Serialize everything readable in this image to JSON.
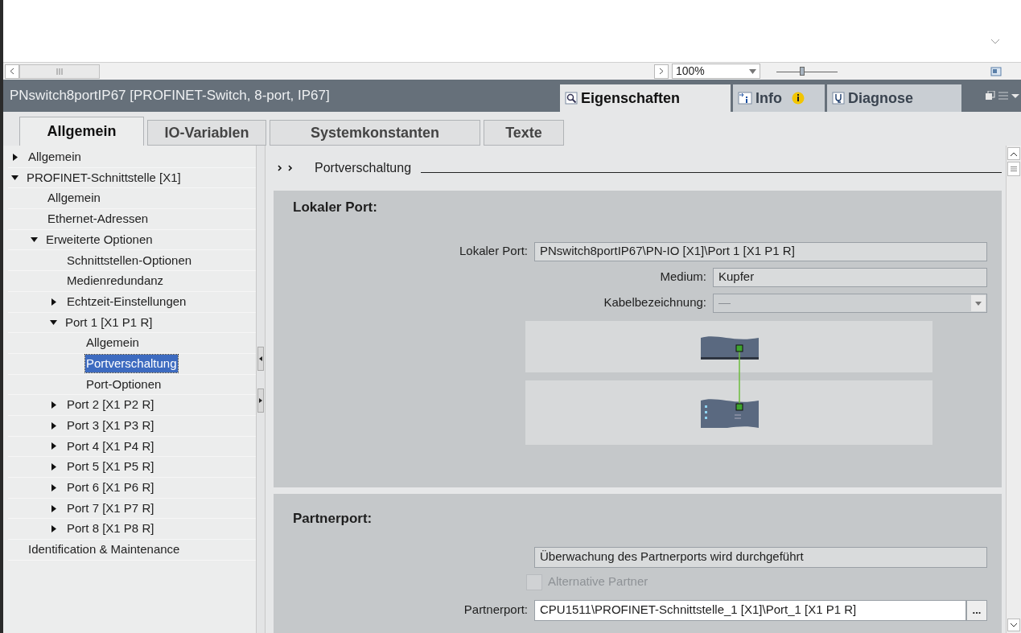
{
  "editor": {
    "zoom": {
      "value": "100%",
      "level": 0.42
    }
  },
  "inspector": {
    "title": "PNswitch8portIP67 [PROFINET-Switch, 8-port, IP67]",
    "tabs": [
      {
        "label": "Eigenschaften",
        "kind": "properties",
        "selected": true
      },
      {
        "label": "Info",
        "kind": "info",
        "selected": false
      },
      {
        "label": "Diagnose",
        "kind": "diagnostics",
        "selected": false
      }
    ]
  },
  "subtabs": [
    {
      "label": "Allgemein",
      "selected": true
    },
    {
      "label": "IO-Variablen",
      "selected": false
    },
    {
      "label": "Systemkonstanten",
      "selected": false
    },
    {
      "label": "Texte",
      "selected": false
    }
  ],
  "tree": [
    {
      "label": "Allgemein",
      "expanded": false,
      "selected": false
    },
    {
      "label": "PROFINET-Schnittstelle [X1]",
      "expanded": true,
      "selected": false,
      "children": [
        {
          "label": "Allgemein",
          "selected": false
        },
        {
          "label": "Ethernet-Adressen",
          "selected": false
        },
        {
          "label": "Erweiterte Optionen",
          "expanded": true,
          "selected": false,
          "children": [
            {
              "label": "Schnittstellen-Optionen",
              "selected": false
            },
            {
              "label": "Medienredundanz",
              "selected": false
            },
            {
              "label": "Echtzeit-Einstellungen",
              "expanded": false,
              "selected": false
            },
            {
              "label": "Port 1 [X1 P1 R]",
              "expanded": true,
              "selected": false,
              "children": [
                {
                  "label": "Allgemein",
                  "selected": false
                },
                {
                  "label": "Portverschaltung",
                  "selected": true
                },
                {
                  "label": "Port-Optionen",
                  "selected": false
                }
              ]
            },
            {
              "label": "Port 2 [X1 P2 R]",
              "expanded": false,
              "selected": false
            },
            {
              "label": "Port 3 [X1 P3 R]",
              "expanded": false,
              "selected": false
            },
            {
              "label": "Port 4 [X1 P4 R]",
              "expanded": false,
              "selected": false
            },
            {
              "label": "Port 5 [X1 P5 R]",
              "expanded": false,
              "selected": false
            },
            {
              "label": "Port 6 [X1 P6 R]",
              "expanded": false,
              "selected": false
            },
            {
              "label": "Port 7 [X1 P7 R]",
              "expanded": false,
              "selected": false
            },
            {
              "label": "Port 8 [X1 P8 R]",
              "expanded": false,
              "selected": false
            }
          ]
        }
      ]
    },
    {
      "label": "Identification & Maintenance",
      "selected": false
    }
  ],
  "breadcrumb": "Portverschaltung",
  "local_port": {
    "heading": "Lokaler Port:",
    "fields": [
      {
        "label": "Lokaler Port:",
        "value": "PNswitch8portIP67\\PN-IO [X1]\\Port 1 [X1 P1 R]",
        "kind": "wide"
      },
      {
        "label": "Medium:",
        "value": "Kupfer",
        "kind": "text"
      },
      {
        "label": "Kabelbezeichnung:",
        "value": "—",
        "kind": "dropdown",
        "disabled": true
      }
    ]
  },
  "partner_port": {
    "heading": "Partnerport:",
    "status": "Überwachung des Partnerports wird durchgeführt",
    "alternative": {
      "label": "Alternative Partner",
      "checked": false,
      "disabled": true
    },
    "field": {
      "label": "Partnerport:",
      "value": "CPU1511\\PROFINET-Schnittstelle_1 [X1]\\Port_1 [X1 P1 R]",
      "button": "..."
    }
  }
}
